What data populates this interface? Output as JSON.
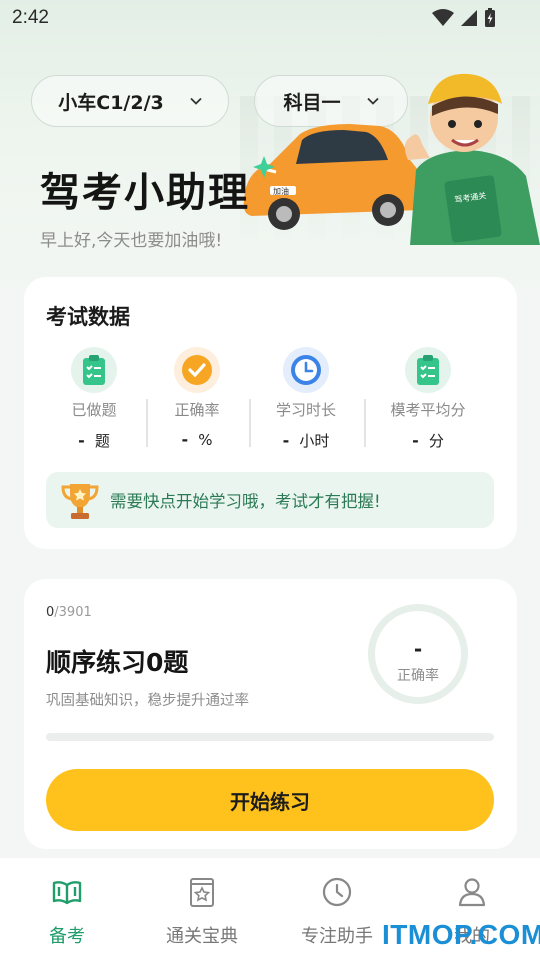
{
  "status_bar": {
    "time": "2:42"
  },
  "header": {
    "vehicle_selector": "小车C1/2/3",
    "subject_selector": "科目一",
    "title": "驾考小助理",
    "greeting": "早上好,今天也要加油哦!",
    "car_plate": "加油",
    "book_text": "驾考通关"
  },
  "exam_data": {
    "title": "考试数据",
    "stats": [
      {
        "label": "已做题",
        "value": "-",
        "unit": "题",
        "icon": "clipboard-icon"
      },
      {
        "label": "正确率",
        "value": "-",
        "unit": "%",
        "icon": "check-circle-icon"
      },
      {
        "label": "学习时长",
        "value": "-",
        "unit": "小时",
        "icon": "clock-icon"
      },
      {
        "label": "模考平均分",
        "value": "-",
        "unit": "分",
        "icon": "clipboard-icon"
      }
    ],
    "tip": "需要快点开始学习哦，考试才有把握!",
    "tip_icon": "trophy-icon"
  },
  "practice": {
    "done": "0",
    "total": "/3901",
    "progress_fraction": 0,
    "title": "顺序练习0题",
    "description": "巩固基础知识，稳步提升通过率",
    "accuracy_value": "-",
    "accuracy_label": "正确率",
    "start_button": "开始练习"
  },
  "bottom_nav": [
    {
      "label": "备考",
      "icon": "book-open-icon",
      "active": true
    },
    {
      "label": "通关宝典",
      "icon": "star-book-icon",
      "active": false
    },
    {
      "label": "专注助手",
      "icon": "clock-icon",
      "active": false
    },
    {
      "label": "我的",
      "icon": "user-icon",
      "active": false
    }
  ],
  "watermark": "ITMOP.COM",
  "colors": {
    "accent": "#1f9e6b",
    "button": "#ffc21c",
    "tip_bg": "#eaf5ef"
  }
}
